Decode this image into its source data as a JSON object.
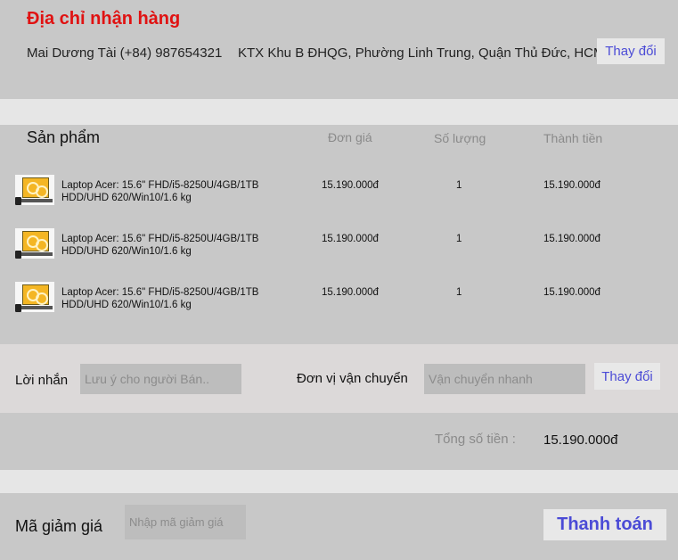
{
  "address": {
    "title": "Địa chỉ nhận hàng",
    "name_phone": "Mai Dương Tài (+84) 987654321",
    "detail": "KTX Khu B ĐHQG, Phường Linh Trung, Quận Thủ Đức, HCM",
    "change_label": "Thay đổi"
  },
  "products": {
    "header_product": "Sản phẩm",
    "header_price": "Đơn giá",
    "header_qty": "Số lượng",
    "header_subtotal": "Thành tiền",
    "items": [
      {
        "icon": "laptop-thumbnail",
        "name": "Laptop Acer: 15.6\" FHD/i5-8250U/4GB/1TB HDD/UHD 620/Win10/1.6 kg",
        "price": "15.190.000đ",
        "qty": "1",
        "subtotal": "15.190.000đ"
      },
      {
        "icon": "laptop-thumbnail",
        "name": "Laptop Acer: 15.6\" FHD/i5-8250U/4GB/1TB HDD/UHD 620/Win10/1.6 kg",
        "price": "15.190.000đ",
        "qty": "1",
        "subtotal": "15.190.000đ"
      },
      {
        "icon": "laptop-thumbnail",
        "name": "Laptop Acer: 15.6\" FHD/i5-8250U/4GB/1TB HDD/UHD 620/Win10/1.6 kg",
        "price": "15.190.000đ",
        "qty": "1",
        "subtotal": "15.190.000đ"
      }
    ]
  },
  "note": {
    "label": "Lời nhắn",
    "placeholder": "Lưu ý cho người Bán..",
    "value": ""
  },
  "shipping": {
    "label": "Đơn vị vận chuyển",
    "placeholder": "Vận chuyển nhanh",
    "value": "",
    "change_label": "Thay đổi"
  },
  "total": {
    "label": "Tổng số tiền :",
    "value": "15.190.000đ"
  },
  "coupon": {
    "label": "Mã giảm giá",
    "placeholder": "Nhập mã giảm giá",
    "value": ""
  },
  "checkout": {
    "label": "Thanh toán"
  },
  "colors": {
    "title_red": "#e01212",
    "link_blue": "#4b4bd6",
    "panel_gray": "#c8c8c8",
    "divider_light": "#e6e6e6"
  }
}
